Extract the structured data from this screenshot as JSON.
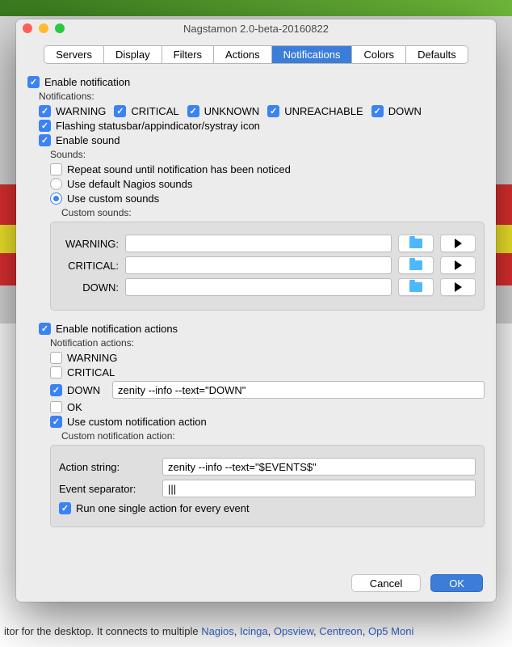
{
  "window": {
    "title": "Nagstamon 2.0-beta-20160822"
  },
  "tabs": [
    "Servers",
    "Display",
    "Filters",
    "Actions",
    "Notifications",
    "Colors",
    "Defaults"
  ],
  "activeTab": "Notifications",
  "enable_notification": "Enable notification",
  "notifications_header": "Notifications:",
  "statuses": {
    "warning": "WARNING",
    "critical": "CRITICAL",
    "unknown": "UNKNOWN",
    "unreachable": "UNREACHABLE",
    "down": "DOWN"
  },
  "flashing": "Flashing statusbar/appindicator/systray icon",
  "enable_sound": "Enable sound",
  "sounds_header": "Sounds:",
  "repeat_sound": "Repeat sound until notification has been noticed",
  "use_default": "Use default Nagios sounds",
  "use_custom": "Use custom sounds",
  "custom_sounds_header": "Custom sounds:",
  "sound_rows": {
    "warning": "WARNING:",
    "critical": "CRITICAL:",
    "down": "DOWN:"
  },
  "enable_actions": "Enable notification actions",
  "actions_header": "Notification actions:",
  "act": {
    "warning": "WARNING",
    "critical": "CRITICAL",
    "down": "DOWN",
    "ok": "OK"
  },
  "down_cmd": "zenity --info --text=\"DOWN\"",
  "use_custom_action": "Use custom notification action",
  "custom_action_header": "Custom notification action:",
  "action_string_lbl": "Action string:",
  "action_string_val": "zenity --info --text=\"$EVENTS$\"",
  "event_sep_lbl": "Event separator:",
  "event_sep_val": "|||",
  "run_single": "Run one single action for every event",
  "buttons": {
    "cancel": "Cancel",
    "ok": "OK"
  },
  "bg_text": {
    "pre": "itor for the desktop. It connects to multiple ",
    "l1": "Nagios",
    "l2": "Icinga",
    "l3": "Opsview",
    "l4": "Centreon",
    "l5": "Op5 Moni"
  }
}
